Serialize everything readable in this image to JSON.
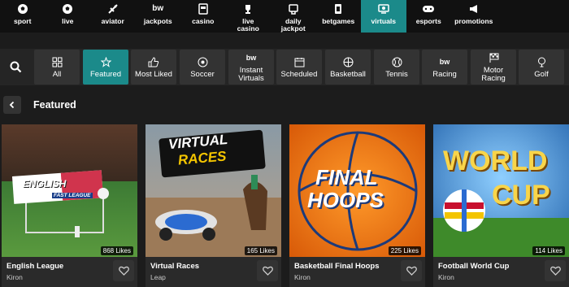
{
  "topnav": [
    {
      "label": "sport",
      "icon": "soccer-ball-icon"
    },
    {
      "label": "live",
      "icon": "soccer-ball-icon"
    },
    {
      "label": "aviator",
      "icon": "plane-icon"
    },
    {
      "label": "jackpots",
      "icon": "bw-logo-icon"
    },
    {
      "label": "casino",
      "icon": "slot-machine-icon"
    },
    {
      "label": "live\ncasino",
      "icon": "trophy-icon"
    },
    {
      "label": "daily\njackpot",
      "icon": "jackpot-icon"
    },
    {
      "label": "betgames",
      "icon": "cards-icon"
    },
    {
      "label": "virtuals",
      "icon": "screen-icon",
      "active": true
    },
    {
      "label": "esports",
      "icon": "gamepad-icon"
    },
    {
      "label": "promotions",
      "icon": "megaphone-icon"
    }
  ],
  "categories": [
    {
      "label": "All",
      "icon": "grid-icon"
    },
    {
      "label": "Featured",
      "icon": "star-icon",
      "active": true
    },
    {
      "label": "Most Liked",
      "icon": "thumbs-up-icon"
    },
    {
      "label": "Soccer",
      "icon": "soccer-ball-icon"
    },
    {
      "label": "Instant\nVirtuals",
      "icon": "bw-logo-icon"
    },
    {
      "label": "Scheduled",
      "icon": "calendar-icon"
    },
    {
      "label": "Basketball",
      "icon": "basketball-icon"
    },
    {
      "label": "Tennis",
      "icon": "tennis-ball-icon"
    },
    {
      "label": "Racing",
      "icon": "bw-logo-icon"
    },
    {
      "label": "Motor\nRacing",
      "icon": "checkered-flag-icon"
    },
    {
      "label": "Golf",
      "icon": "golf-icon"
    }
  ],
  "section": {
    "title": "Featured"
  },
  "games": [
    {
      "name": "English League",
      "provider": "Kiron",
      "likes": "868 Likes",
      "art_text": "ENGLISH",
      "art_sub": "FAST LEAGUE"
    },
    {
      "name": "Virtual Races",
      "provider": "Leap",
      "likes": "165 Likes",
      "art_text": "VIRTUAL",
      "art_sub": "RACES"
    },
    {
      "name": "Basketball Final Hoops",
      "provider": "Kiron",
      "likes": "225 Likes",
      "art_text": "FINAL",
      "art_sub": "HOOPS"
    },
    {
      "name": "Football World Cup",
      "provider": "Kiron",
      "likes": "114 Likes",
      "art_text": "WORLD",
      "art_sub": "CUP"
    }
  ],
  "colors": {
    "accent": "#1b8a8a",
    "bg": "#1c1c1c",
    "tile": "#333333"
  }
}
